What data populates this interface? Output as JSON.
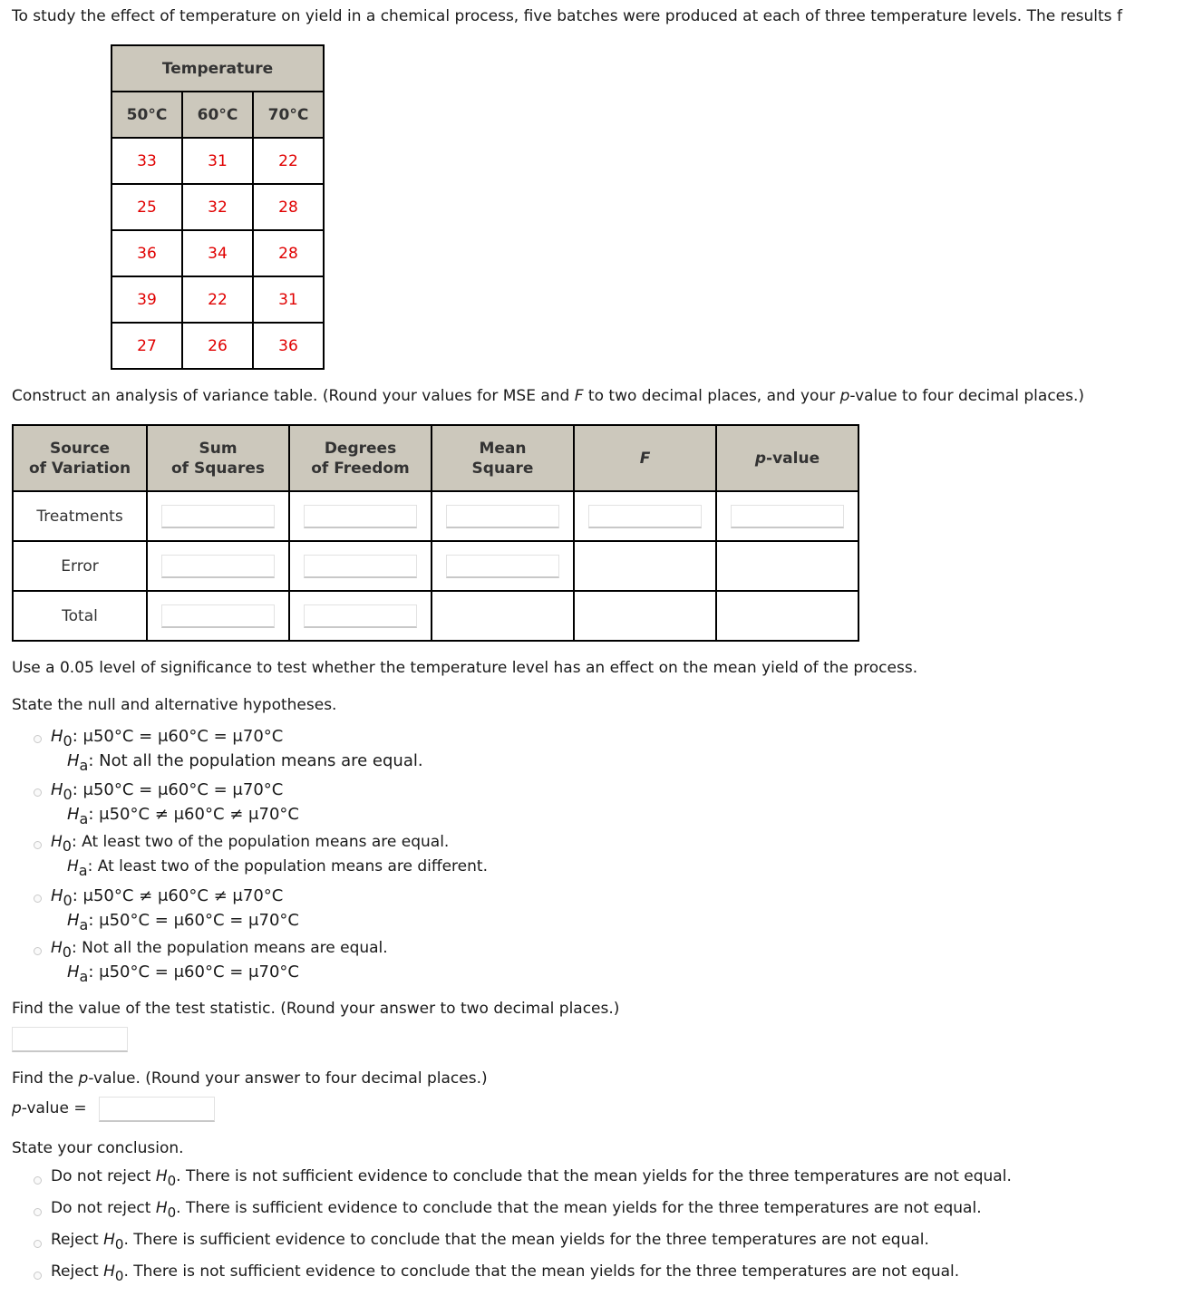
{
  "intro": "To study the effect of temperature on yield in a chemical process, five batches were produced at each of three temperature levels. The results f",
  "temperature_table": {
    "title": "Temperature",
    "columns": [
      "50°C",
      "60°C",
      "70°C"
    ],
    "rows": [
      [
        "33",
        "31",
        "22"
      ],
      [
        "25",
        "32",
        "28"
      ],
      [
        "36",
        "34",
        "28"
      ],
      [
        "39",
        "22",
        "31"
      ],
      [
        "27",
        "26",
        "36"
      ]
    ]
  },
  "anova_instruction": {
    "pre": "Construct an analysis of variance table. (Round your values for MSE and ",
    "F": "F",
    "mid": " to two decimal places, and your ",
    "p": "p",
    "post": "-value to four decimal places.)"
  },
  "anova_table": {
    "headers": [
      [
        "Source",
        "of Variation"
      ],
      [
        "Sum",
        "of Squares"
      ],
      [
        "Degrees",
        "of Freedom"
      ],
      [
        "Mean",
        "Square"
      ],
      [
        "F"
      ],
      [
        "p",
        "-value"
      ]
    ],
    "rows": [
      {
        "label": "Treatments",
        "sum_of_squares": "",
        "degrees_of_freedom": "",
        "mean_square": "",
        "f": "",
        "p_value": ""
      },
      {
        "label": "Error",
        "sum_of_squares": "",
        "degrees_of_freedom": "",
        "mean_square": ""
      },
      {
        "label": "Total",
        "sum_of_squares": "",
        "degrees_of_freedom": ""
      }
    ]
  },
  "significance_text": "Use a 0.05 level of significance to test whether the temperature level has an effect on the mean yield of the process.",
  "hypotheses": {
    "prompt": "State the null and alternative hypotheses.",
    "H": "H",
    "sub0": "0",
    "suba": "a",
    "options": [
      {
        "h0": "μ50°C = μ60°C = μ70°C",
        "ha": "Not all the population means are equal."
      },
      {
        "h0": "μ50°C = μ60°C = μ70°C",
        "ha": "μ50°C ≠ μ60°C ≠ μ70°C"
      },
      {
        "h0": "At least two of the population means are equal.",
        "ha": "At least two of the population means are different."
      },
      {
        "h0": "μ50°C ≠ μ60°C ≠ μ70°C",
        "ha": "μ50°C = μ60°C = μ70°C"
      },
      {
        "h0": "Not all the population means are equal.",
        "ha": "μ50°C = μ60°C = μ70°C"
      }
    ]
  },
  "test_statistic": {
    "prompt": "Find the value of the test statistic. (Round your answer to two decimal places.)",
    "value": ""
  },
  "p_value": {
    "prompt_pre": "Find the ",
    "p": "p",
    "prompt_post": "-value. (Round your answer to four decimal places.)",
    "label_post": "-value =",
    "value": ""
  },
  "conclusion": {
    "prompt": "State your conclusion.",
    "options": [
      {
        "action": "Do not reject ",
        "text": ". There is not sufficient evidence to conclude that the mean yields for the three temperatures are not equal."
      },
      {
        "action": "Do not reject ",
        "text": ". There is sufficient evidence to conclude that the mean yields for the three temperatures are not equal."
      },
      {
        "action": "Reject ",
        "text": ". There is sufficient evidence to conclude that the mean yields for the three temperatures are not equal."
      },
      {
        "action": "Reject ",
        "text": ". There is not sufficient evidence to conclude that the mean yields for the three temperatures are not equal."
      }
    ]
  }
}
